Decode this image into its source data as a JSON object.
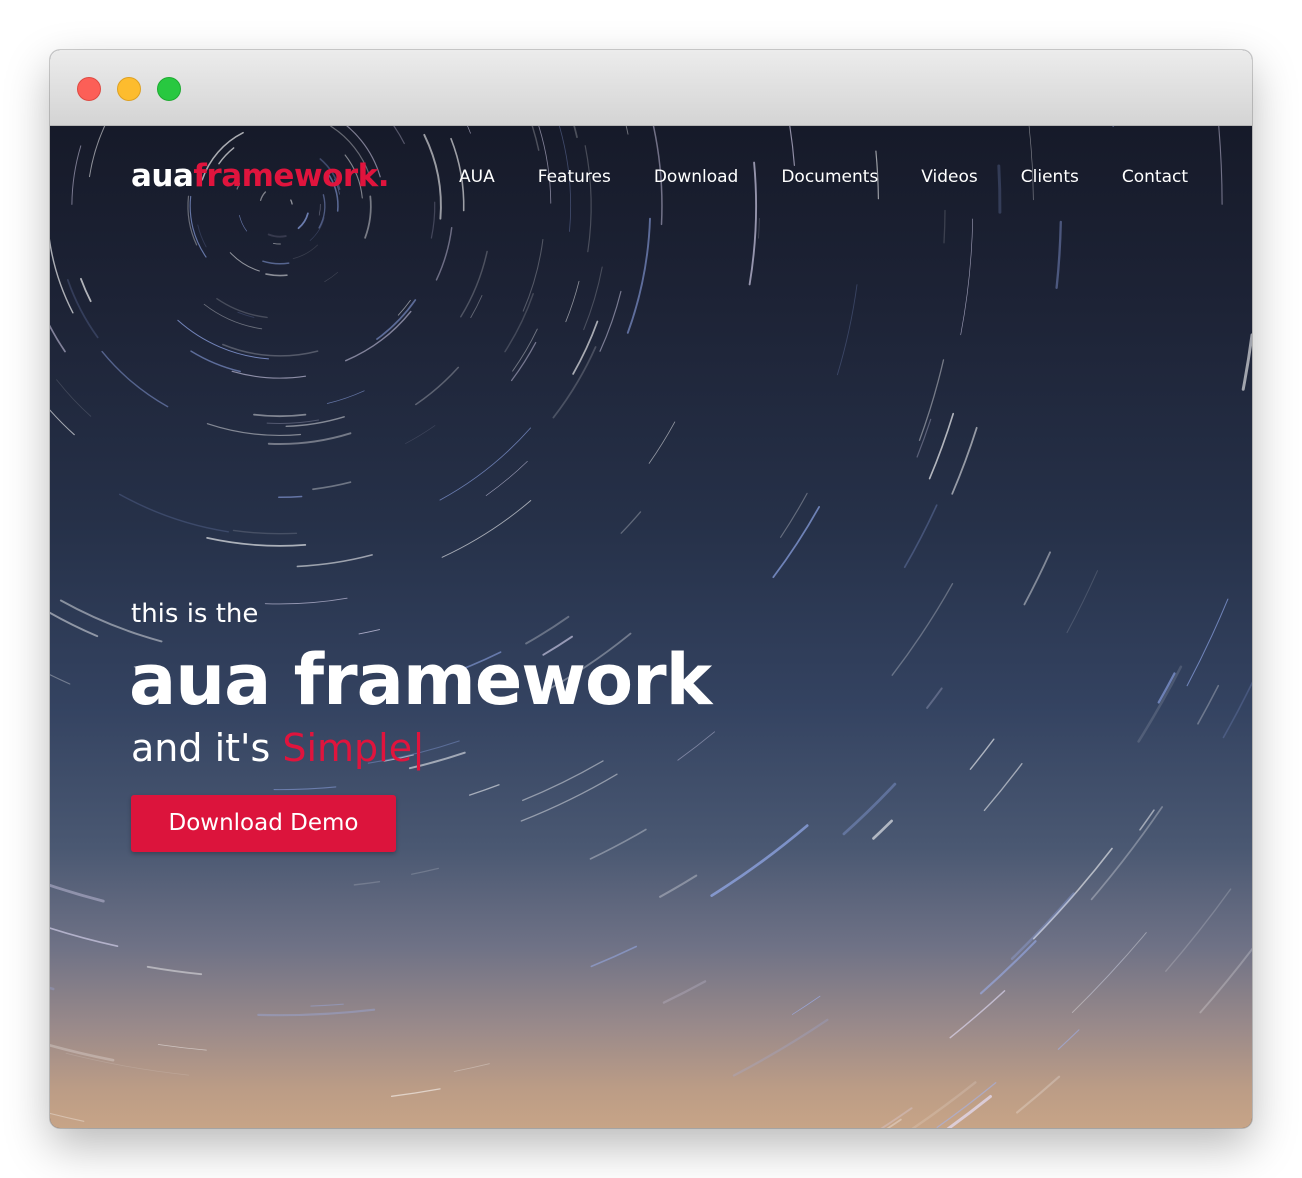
{
  "window": {
    "controls": [
      "close",
      "minimize",
      "maximize"
    ]
  },
  "brand": {
    "logo_part1": "aua",
    "logo_part2": "framework."
  },
  "nav": {
    "items": [
      {
        "label": "AUA"
      },
      {
        "label": "Features"
      },
      {
        "label": "Download"
      },
      {
        "label": "Documents"
      },
      {
        "label": "Videos"
      },
      {
        "label": "Clients"
      },
      {
        "label": "Contact"
      }
    ]
  },
  "hero": {
    "intro": "this is the",
    "headline": "aua framework",
    "tagline_prefix": "and it's ",
    "tagline_highlight": "Simple",
    "cursor": "|",
    "cta_label": "Download Demo",
    "background": "star-trails-night-sky"
  },
  "colors": {
    "accent": "#dc143c",
    "text": "#ffffff",
    "sky_top": "#161a29",
    "horizon": "#c7a487"
  }
}
